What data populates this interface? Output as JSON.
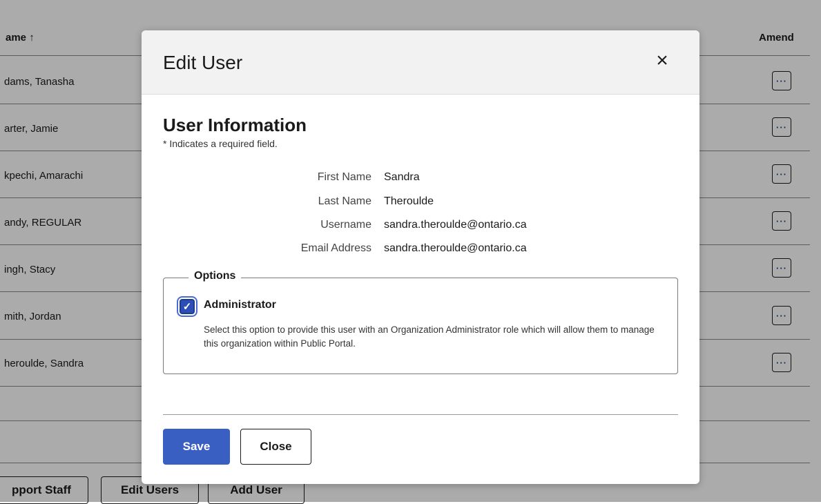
{
  "table": {
    "name_header": "ame ↑",
    "amend_header": "Amend",
    "rows": [
      {
        "name": "dams, Tanasha"
      },
      {
        "name": "arter, Jamie"
      },
      {
        "name": "kpechi, Amarachi"
      },
      {
        "name": "andy, REGULAR"
      },
      {
        "name": "ingh, Stacy"
      },
      {
        "name": "mith, Jordan"
      },
      {
        "name": "heroulde, Sandra"
      }
    ],
    "amend_button_label": "···"
  },
  "bottom_buttons": {
    "support_staff": "pport Staff",
    "edit_users": "Edit Users",
    "add_user": "Add User"
  },
  "modal": {
    "title": "Edit User",
    "close_symbol": "×",
    "section_title": "User Information",
    "required_note": "* Indicates a required field.",
    "fields": [
      {
        "label": "First Name",
        "value": "Sandra"
      },
      {
        "label": "Last Name",
        "value": "Theroulde"
      },
      {
        "label": "Username",
        "value": "sandra.theroulde@ontario.ca"
      },
      {
        "label": "Email Address",
        "value": "sandra.theroulde@ontario.ca"
      }
    ],
    "options": {
      "legend": "Options",
      "administrator_label": "Administrator",
      "administrator_checked": true,
      "administrator_desc": "Select this option to provide this user with an Organization Administrator role which will allow them to manage this organization within Public Portal."
    },
    "save_label": "Save",
    "close_label": "Close"
  },
  "colors": {
    "accent": "#3a5fc2",
    "overlay": "rgba(0,0,0,0.33)"
  }
}
